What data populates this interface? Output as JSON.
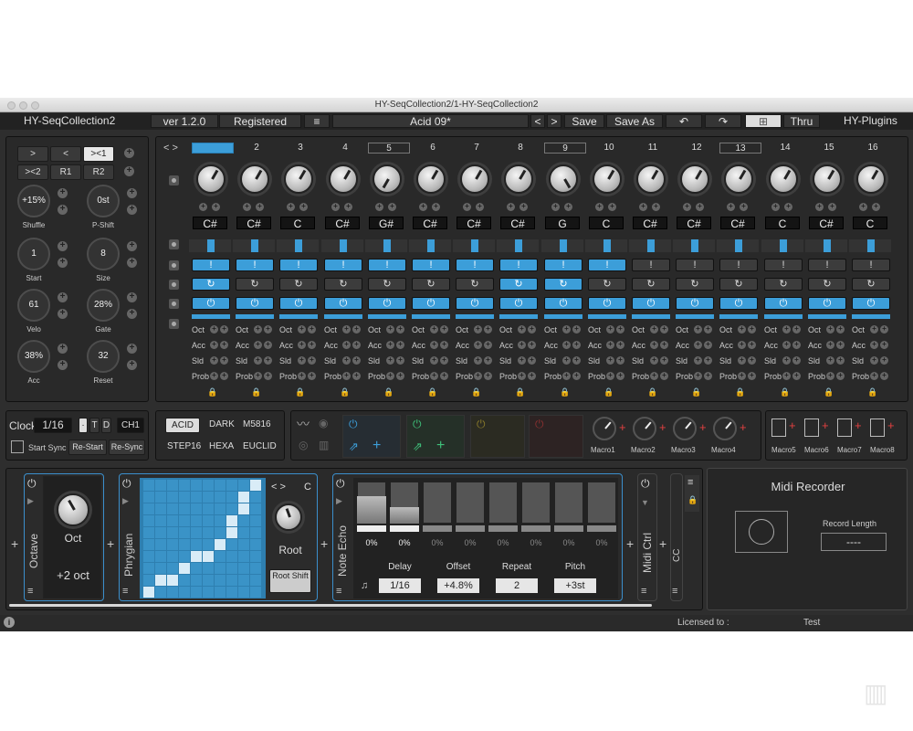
{
  "window": {
    "title": "HY-SeqCollection2/1-HY-SeqCollection2"
  },
  "top": {
    "brand": "HY-SeqCollection2",
    "version": "ver 1.2.0",
    "registered": "Registered",
    "menu": "≡",
    "preset": "Acid 09*",
    "prev": "<",
    "next": ">",
    "save": "Save",
    "saveas": "Save As",
    "thru": "Thru",
    "company": "HY-Plugins"
  },
  "left": {
    "btn_next": ">",
    "btn_prev": "<",
    "btn_gt1": "><1",
    "btn_gt2": "><2",
    "btn_r1": "R1",
    "btn_r2": "R2",
    "knobs": [
      {
        "value": "+15%",
        "label": "Shuffle"
      },
      {
        "value": "0st",
        "label": "P-Shift"
      },
      {
        "value": "1",
        "label": "Start"
      },
      {
        "value": "8",
        "label": "Size"
      },
      {
        "value": "61",
        "label": "Velo"
      },
      {
        "value": "28%",
        "label": "Gate"
      },
      {
        "value": "38%",
        "label": "Acc"
      },
      {
        "value": "32",
        "label": "Reset"
      }
    ]
  },
  "steps": {
    "numbers": [
      "1",
      "2",
      "3",
      "4",
      "5",
      "6",
      "7",
      "8",
      "9",
      "10",
      "11",
      "12",
      "13",
      "14",
      "15",
      "16"
    ],
    "notes": [
      "C#",
      "C#",
      "C",
      "C#",
      "G#",
      "C#",
      "C#",
      "C#",
      "G",
      "C",
      "C#",
      "C#",
      "C#",
      "C",
      "C#",
      "C"
    ],
    "bang": "!",
    "rowlabels": [
      "Oct",
      "Acc",
      "Sld",
      "Prob"
    ],
    "nav": "< >"
  },
  "clock": {
    "label": "Clock",
    "value": "1/16",
    "dot": "·",
    "t": "T",
    "d": "D",
    "ch": "CH1",
    "startsync": "Start Sync",
    "restart": "Re-Start",
    "resync": "Re-Sync"
  },
  "modes": {
    "items": [
      "ACID",
      "DARK",
      "M5816",
      "STEP16",
      "HEXA",
      "EUCLID"
    ]
  },
  "macros": {
    "items": [
      "Macro1",
      "Macro2",
      "Macro3",
      "Macro4",
      "Macro5",
      "Macro6",
      "Macro7",
      "Macro8"
    ]
  },
  "octave": {
    "title": "Octave",
    "knob": "Oct",
    "value": "+2 oct"
  },
  "phrygian": {
    "title": "Phrygian",
    "nav": "< >",
    "key": "C",
    "knob": "Root",
    "rootshift": "Root Shift"
  },
  "echo": {
    "title": "Note Echo",
    "percents": [
      "0%",
      "0%",
      "0%",
      "0%",
      "0%",
      "0%",
      "0%",
      "0%"
    ],
    "params": [
      {
        "label": "Delay",
        "value": "1/16"
      },
      {
        "label": "Offset",
        "value": "+4.8%"
      },
      {
        "label": "Repeat",
        "value": "2"
      },
      {
        "label": "Pitch",
        "value": "+3st"
      }
    ]
  },
  "midictrl": {
    "title": "Midi Ctrl",
    "short": "CC"
  },
  "recorder": {
    "title": "Midi Recorder",
    "length_label": "Record Length",
    "length_value": "----"
  },
  "footer": {
    "licensed": "Licensed to :",
    "user": "Test",
    "info": "i"
  }
}
